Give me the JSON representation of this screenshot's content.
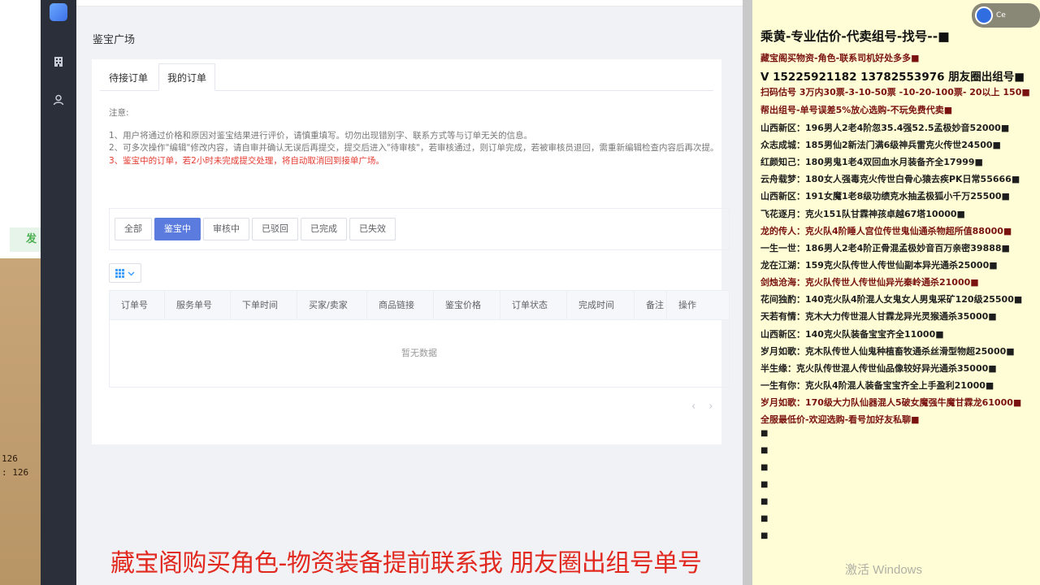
{
  "left_strip": {
    "green_label": "发",
    "numbers": [
      "126",
      ": 126"
    ]
  },
  "app": {
    "page_title": "鉴宝广场",
    "tabs": [
      {
        "label": "待接订单"
      },
      {
        "label": "我的订单"
      }
    ],
    "notice": {
      "title": "注意:",
      "items": [
        "1、用户将通过价格和原因对鉴宝结果进行评价，请慎重填写。切勿出现错别字、联系方式等与订单无关的信息。",
        "2、可多次操作\"编辑\"修改内容，请自审并确认无误后再提交，提交后进入\"待审核\"，若审核通过，则订单完成，若被审核员退回，需重新编辑检查内容后再次提。",
        "3、鉴宝中的订单，若2小时未完成提交处理，将自动取消回到接单广场。"
      ]
    },
    "filters": [
      "全部",
      "鉴宝中",
      "审核中",
      "已驳回",
      "已完成",
      "已失效"
    ],
    "table": {
      "columns": [
        "订单号",
        "服务单号",
        "下单时间",
        "买家/卖家",
        "商品链接",
        "鉴宝价格",
        "订单状态",
        "完成时间",
        "备注",
        "操作"
      ],
      "empty_text": "暂无数据"
    }
  },
  "notepad": {
    "badge_text": "Ce",
    "lines": [
      "乘黄-专业估价-代卖组号-找号--■",
      "藏宝阁买物资-角色-联系司机好处多多■",
      "V 15225921182   13782553976 朋友圈出组号■",
      "扫码估号 3万内30票-3-10-50票  -10-20-100票- 20以上 150■",
      "帮出组号-单号误差5%放心选购-不玩免费代卖■",
      "山西新区：196男人2老4阶忽35.4强52.5孟极妙音52000■",
      "众志成城：185男仙2新法门满6级神兵雷克火传世24500■",
      "红颜知己：180男鬼1老4双回血水月装备齐全17999■",
      "云舟载梦：180女人强毒克火传世白骨心猿去疾PK日常55666■",
      "山西新区：191女魔1老8级功绩克水抽孟极狐小千万25500■",
      "飞花逐月：克火151队甘霖神孩卓越67塔10000■",
      "龙的传人：克火队4阶睡人宫位传世鬼仙通杀物超所值88000■",
      "一生一世：186男人2老4阶正骨混孟极妙音百万亲密39888■",
      "龙在江湖：159克火队传世人传世仙副本异光通杀25000■",
      "剑烛沧海：克火队传世人传世仙异光秦岭通杀21000■",
      "花间独酌：140克火队4阶混人女鬼女人男鬼采矿120级25500■",
      "天若有情：克木大力传世混人甘霖龙异光灵猴通杀35000■",
      "山西新区：140克火队装备宝宝齐全11000■",
      "岁月如歌：克木队传世人仙鬼种植畜牧通杀丝滑型物超25000■",
      "半生缘：克火队传世混人传世仙品像较好异光通杀35000■",
      "一生有你：克火队4阶混人装备宝宝齐全上手盈利21000■",
      "岁月如歌：170级大力队仙器混人5破女魔强牛魔甘霖龙61000■",
      "全服最低价-欢迎选购-看号加好友私聊■",
      "■",
      "■",
      "■",
      "■",
      "■",
      "■",
      "■"
    ]
  },
  "overlay": {
    "bottom_ad": "藏宝阁购买角色-物资装备提前联系我      朋友圈出组号单号",
    "watermark": "激活 Windows"
  },
  "colors": {
    "sidebar": "#2b2f3a",
    "primary": "#5b7bdf",
    "warning_red": "#e4392f",
    "notepad_bg": "#fffdd5",
    "ad_red": "#e2291f"
  }
}
